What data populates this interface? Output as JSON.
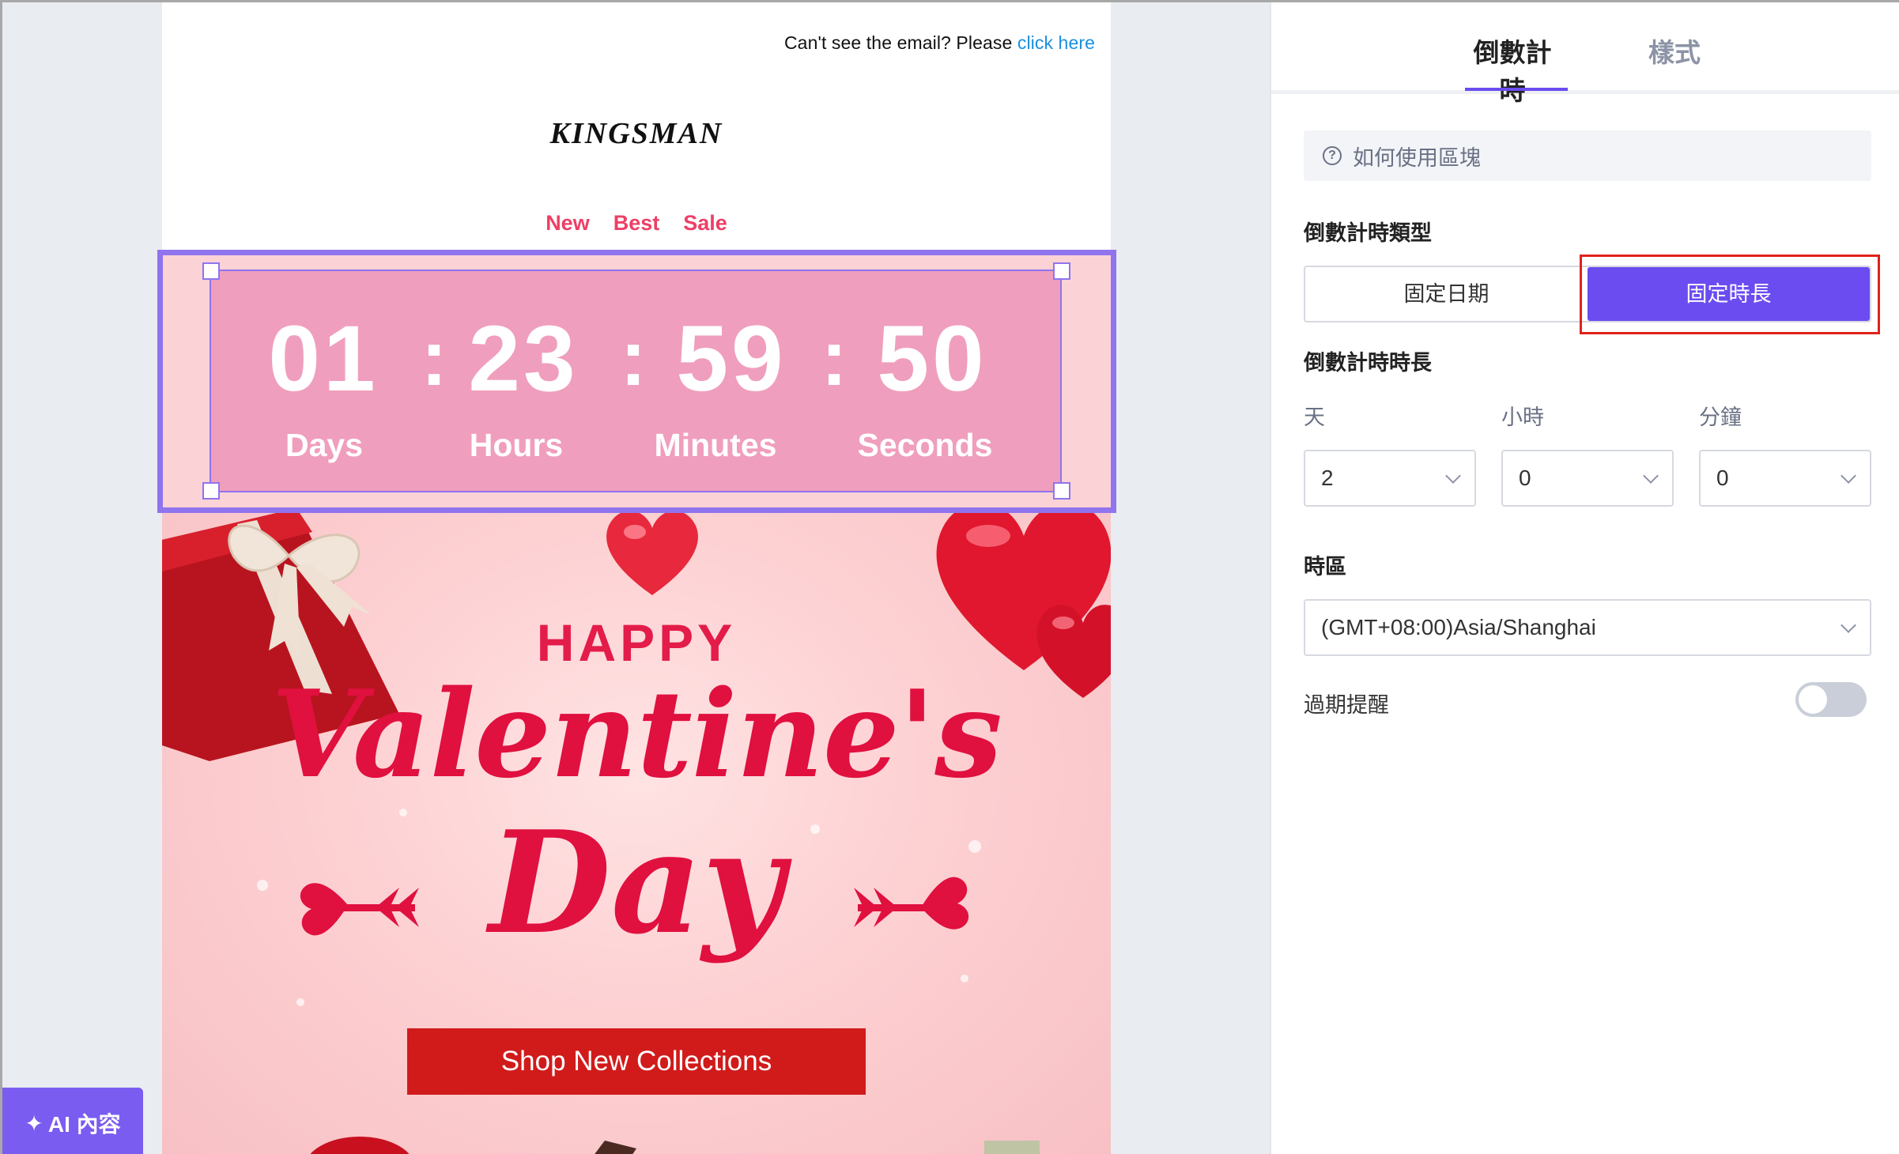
{
  "email": {
    "preheader_text": "Can't see the email? Please",
    "preheader_link": "click here",
    "logo": "KINGSMAN",
    "nav": [
      "New",
      "Best",
      "Sale"
    ],
    "countdown": {
      "days": "01",
      "hours": "23",
      "minutes": "59",
      "seconds": "50",
      "separator": ":",
      "labels": [
        "Days",
        "Hours",
        "Minutes",
        "Seconds"
      ]
    },
    "hero": {
      "happy": "HAPPY",
      "title_line1": "Valentine's",
      "title_line2": "Day",
      "cta": "Shop New Collections"
    }
  },
  "ai_button": {
    "icon": "sparkle-icon",
    "label": "AI 內容"
  },
  "panel": {
    "tabs": [
      "倒數計時",
      "樣式"
    ],
    "active_tab": "倒數計時",
    "help_text": "如何使用區塊",
    "type_section_title": "倒數計時類型",
    "type_options": [
      "固定日期",
      "固定時長"
    ],
    "type_selected": "固定時長",
    "duration_section_title": "倒數計時時長",
    "duration_fields": [
      {
        "label": "天",
        "value": "2"
      },
      {
        "label": "小時",
        "value": "0"
      },
      {
        "label": "分鐘",
        "value": "0"
      }
    ],
    "timezone_title": "時區",
    "timezone_value": "(GMT+08:00)Asia/Shanghai",
    "expiry_label": "過期提醒",
    "expiry_enabled": false
  },
  "colors": {
    "accent": "#6b4cf0",
    "selection": "#8f74ee",
    "highlight_box": "#e0221b",
    "nav": "#ee3f66",
    "cta": "#d11b1b",
    "countdown_bg": "#f09ebd"
  }
}
